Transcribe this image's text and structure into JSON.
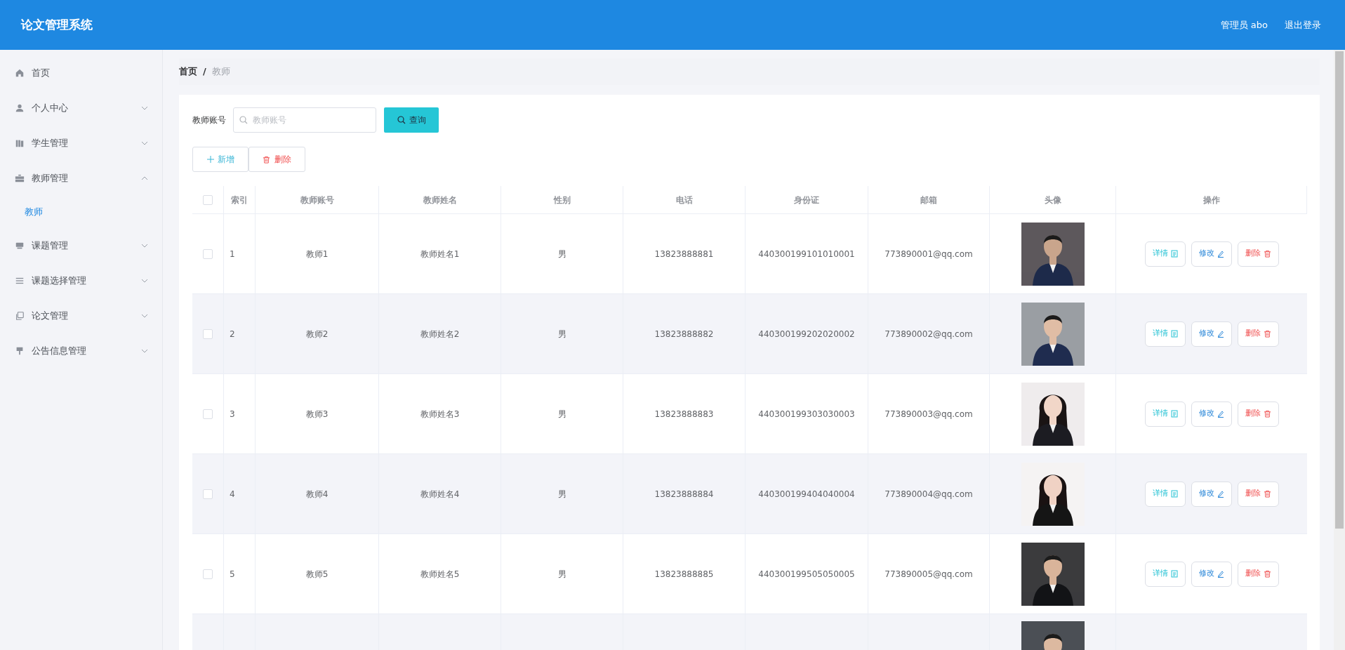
{
  "header": {
    "title": "论文管理系统",
    "user": "管理员 abo",
    "logout": "退出登录"
  },
  "sidebar": {
    "items": [
      {
        "kind": "link",
        "label": "首页"
      },
      {
        "kind": "submenu",
        "label": "个人中心",
        "expanded": false
      },
      {
        "kind": "submenu",
        "label": "学生管理",
        "expanded": false
      },
      {
        "kind": "submenu",
        "label": "教师管理",
        "expanded": true,
        "children": [
          {
            "label": "教师",
            "selected": true
          }
        ]
      },
      {
        "kind": "submenu",
        "label": "课题管理",
        "expanded": false
      },
      {
        "kind": "submenu",
        "label": "课题选择管理",
        "expanded": false
      },
      {
        "kind": "submenu",
        "label": "论文管理",
        "expanded": false
      },
      {
        "kind": "submenu",
        "label": "公告信息管理",
        "expanded": false
      }
    ]
  },
  "breadcrumb": {
    "items": [
      "首页",
      "教师"
    ],
    "separator": "/"
  },
  "search": {
    "label": "教师账号",
    "placeholder": "教师账号",
    "button": "查询"
  },
  "actions": {
    "add": "新增",
    "delete": "删除"
  },
  "table": {
    "all_checked": false,
    "columns": [
      "索引",
      "教师账号",
      "教师姓名",
      "性别",
      "电话",
      "身份证",
      "邮箱",
      "头像",
      "操作"
    ],
    "rows": [
      {
        "checked": false,
        "index": "1",
        "account": "教师1",
        "name": "教师姓名1",
        "gender": "男",
        "phone": "13823888881",
        "id_card": "440300199101010001",
        "email": "773890001@qq.com",
        "buttons": {
          "detail": "详情",
          "edit": "修改",
          "delete": "删除"
        }
      },
      {
        "checked": false,
        "index": "2",
        "account": "教师2",
        "name": "教师姓名2",
        "gender": "男",
        "phone": "13823888882",
        "id_card": "440300199202020002",
        "email": "773890002@qq.com",
        "buttons": {
          "detail": "详情",
          "edit": "修改",
          "delete": "删除"
        }
      },
      {
        "checked": false,
        "index": "3",
        "account": "教师3",
        "name": "教师姓名3",
        "gender": "男",
        "phone": "13823888883",
        "id_card": "440300199303030003",
        "email": "773890003@qq.com",
        "buttons": {
          "detail": "详情",
          "edit": "修改",
          "delete": "删除"
        }
      },
      {
        "checked": false,
        "index": "4",
        "account": "教师4",
        "name": "教师姓名4",
        "gender": "男",
        "phone": "13823888884",
        "id_card": "440300199404040004",
        "email": "773890004@qq.com",
        "buttons": {
          "detail": "详情",
          "edit": "修改",
          "delete": "删除"
        }
      },
      {
        "checked": false,
        "index": "5",
        "account": "教师5",
        "name": "教师姓名5",
        "gender": "男",
        "phone": "13823888885",
        "id_card": "440300199505050005",
        "email": "773890005@qq.com",
        "buttons": {
          "detail": "详情",
          "edit": "修改",
          "delete": "删除"
        }
      }
    ]
  }
}
